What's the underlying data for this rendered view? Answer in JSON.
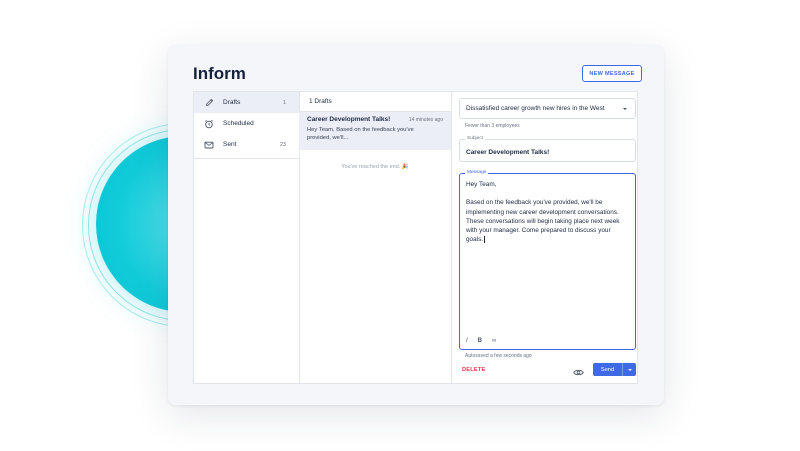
{
  "app": {
    "title": "Inform",
    "new_message_label": "NEW MESSAGE"
  },
  "folders": [
    {
      "label": "Drafts",
      "count": "1",
      "icon": "pencil-icon",
      "active": true
    },
    {
      "label": "Scheduled",
      "count": "",
      "icon": "alarm-clock-icon",
      "active": false
    },
    {
      "label": "Sent",
      "count": "23",
      "icon": "envelope-icon",
      "active": false
    }
  ],
  "list": {
    "header": "1 Drafts",
    "items": [
      {
        "subject": "Career Development Talks!",
        "time": "14 minutes ago",
        "preview": "Hey Team, Based on the feedback you've provided, we'll..."
      }
    ],
    "end_note": "You've reached the end. 🎉"
  },
  "compose": {
    "audience": "Dissatisfied career growth new hires in the West",
    "audience_helper": "Fewer than 3 employees",
    "subject_label": "Subject",
    "subject_value": "Career Development Talks!",
    "message_label": "Message",
    "message_body": "Hey Team,\n\nBased on the feedback you've provided, we'll be implementing new career development conversations. These conversations will begin taking place next week with your manager. Come prepared to discuss your goals.",
    "toolbar": [
      {
        "label": "I",
        "icon": "italic-icon"
      },
      {
        "label": "B",
        "icon": "bold-icon"
      },
      {
        "label": "∞",
        "icon": "link-icon"
      }
    ],
    "autosave": "Autosaved a few seconds ago",
    "delete_label": "DELETE",
    "send_label": "Send"
  },
  "colors": {
    "accent": "#3f6ae6",
    "danger": "#e2364a",
    "teal": "#11cbd9"
  }
}
